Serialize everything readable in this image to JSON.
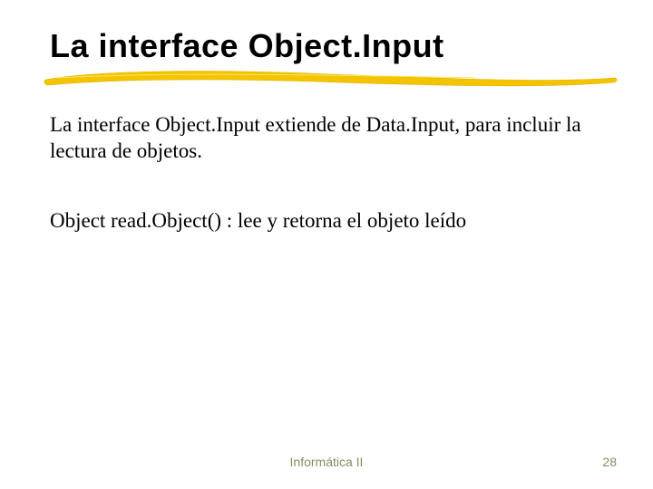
{
  "title": "La interface Object.Input",
  "paragraph1": "La interface Object.Input extiende de Data.Input, para incluir la lectura de objetos.",
  "paragraph2": "Object read.Object() : lee y retorna el objeto leído",
  "footer_center": "Informática II",
  "page_number": "28",
  "accent_color": "#f5c400"
}
